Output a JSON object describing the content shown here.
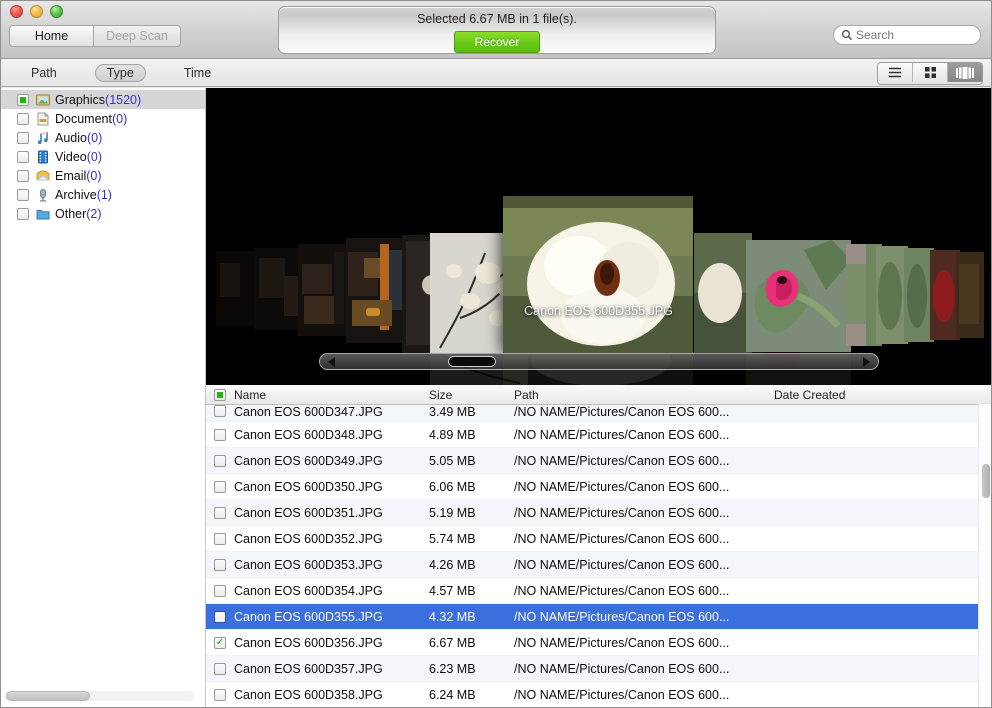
{
  "window": {
    "traffic_lights": [
      "close",
      "minimize",
      "zoom"
    ]
  },
  "toolbar": {
    "home_label": "Home",
    "deep_scan_label": "Deep Scan",
    "status_text": "Selected 6.67 MB in 1 file(s).",
    "recover_label": "Recover",
    "search_placeholder": "Search",
    "search_value": "",
    "accent_green": "#68c918",
    "selection_blue": "#3a6fdd"
  },
  "filters": {
    "items": [
      {
        "label": "Path",
        "active": false
      },
      {
        "label": "Type",
        "active": true
      },
      {
        "label": "Time",
        "active": false
      }
    ]
  },
  "view_modes": [
    {
      "name": "list-view",
      "active": false
    },
    {
      "name": "icon-view",
      "active": false
    },
    {
      "name": "coverflow-view",
      "active": true
    }
  ],
  "sidebar": {
    "items": [
      {
        "label": "Graphics",
        "count": "(1520)",
        "icon": "image-icon",
        "checked": true,
        "selected": true
      },
      {
        "label": "Document",
        "count": "(0)",
        "icon": "document-icon",
        "checked": false,
        "selected": false
      },
      {
        "label": "Audio",
        "count": "(0)",
        "icon": "music-note-icon",
        "checked": false,
        "selected": false
      },
      {
        "label": "Video",
        "count": "(0)",
        "icon": "film-icon",
        "checked": false,
        "selected": false
      },
      {
        "label": "Email",
        "count": "(0)",
        "icon": "envelope-icon",
        "checked": false,
        "selected": false
      },
      {
        "label": "Archive",
        "count": "(1)",
        "icon": "archive-icon",
        "checked": false,
        "selected": false
      },
      {
        "label": "Other",
        "count": "(2)",
        "icon": "folder-icon",
        "checked": false,
        "selected": false
      }
    ]
  },
  "preview": {
    "caption": "Canon EOS 600D355.JPG"
  },
  "file_list": {
    "columns": [
      "Name",
      "Size",
      "Path",
      "Date Created"
    ],
    "rows": [
      {
        "name": "Canon EOS 600D347.JPG",
        "size": "3.49 MB",
        "path": "/NO NAME/Pictures/Canon EOS 600...",
        "date": "",
        "checked": false,
        "selected": false
      },
      {
        "name": "Canon EOS 600D348.JPG",
        "size": "4.89 MB",
        "path": "/NO NAME/Pictures/Canon EOS 600...",
        "date": "",
        "checked": false,
        "selected": false
      },
      {
        "name": "Canon EOS 600D349.JPG",
        "size": "5.05 MB",
        "path": "/NO NAME/Pictures/Canon EOS 600...",
        "date": "",
        "checked": false,
        "selected": false
      },
      {
        "name": "Canon EOS 600D350.JPG",
        "size": "6.06 MB",
        "path": "/NO NAME/Pictures/Canon EOS 600...",
        "date": "",
        "checked": false,
        "selected": false
      },
      {
        "name": "Canon EOS 600D351.JPG",
        "size": "5.19 MB",
        "path": "/NO NAME/Pictures/Canon EOS 600...",
        "date": "",
        "checked": false,
        "selected": false
      },
      {
        "name": "Canon EOS 600D352.JPG",
        "size": "5.74 MB",
        "path": "/NO NAME/Pictures/Canon EOS 600...",
        "date": "",
        "checked": false,
        "selected": false
      },
      {
        "name": "Canon EOS 600D353.JPG",
        "size": "4.26 MB",
        "path": "/NO NAME/Pictures/Canon EOS 600...",
        "date": "",
        "checked": false,
        "selected": false
      },
      {
        "name": "Canon EOS 600D354.JPG",
        "size": "4.57 MB",
        "path": "/NO NAME/Pictures/Canon EOS 600...",
        "date": "",
        "checked": false,
        "selected": false
      },
      {
        "name": "Canon EOS 600D355.JPG",
        "size": "4.32 MB",
        "path": "/NO NAME/Pictures/Canon EOS 600...",
        "date": "",
        "checked": false,
        "selected": true
      },
      {
        "name": "Canon EOS 600D356.JPG",
        "size": "6.67 MB",
        "path": "/NO NAME/Pictures/Canon EOS 600...",
        "date": "",
        "checked": true,
        "selected": false
      },
      {
        "name": "Canon EOS 600D357.JPG",
        "size": "6.23 MB",
        "path": "/NO NAME/Pictures/Canon EOS 600...",
        "date": "",
        "checked": false,
        "selected": false
      },
      {
        "name": "Canon EOS 600D358.JPG",
        "size": "6.24 MB",
        "path": "/NO NAME/Pictures/Canon EOS 600...",
        "date": "",
        "checked": false,
        "selected": false
      }
    ]
  }
}
